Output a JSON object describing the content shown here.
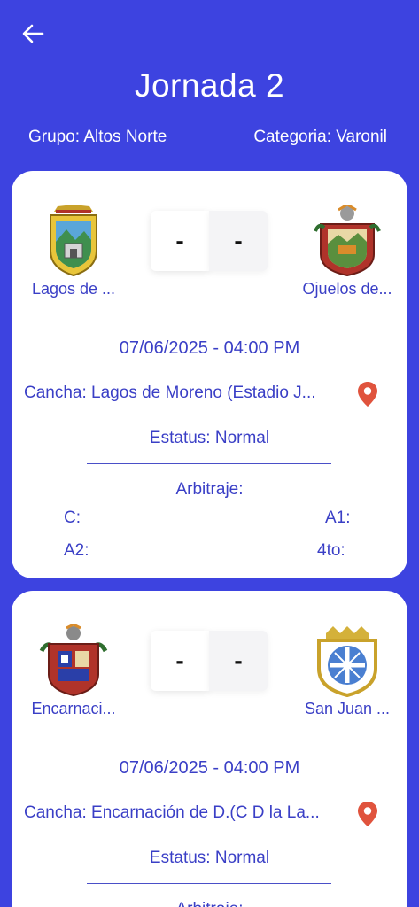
{
  "header": {
    "back_icon": "arrow-left-icon",
    "title": "Jornada 2",
    "group_text": "Grupo: Altos Norte",
    "category_text": "Categoria: Varonil"
  },
  "matches": [
    {
      "home_name": "Lagos de ...",
      "away_name": "Ojuelos de...",
      "home_score": "-",
      "away_score": "-",
      "datetime": "07/06/2025 - 04:00 PM",
      "venue": "Cancha: Lagos de Moreno (Estadio J...",
      "status": "Estatus: Normal",
      "referees_title": "Arbitraje:",
      "ref_c": "C:",
      "ref_a1": "A1:",
      "ref_a2": "A2:",
      "ref_4to": "4to:"
    },
    {
      "home_name": "Encarnaci...",
      "away_name": "San Juan ...",
      "home_score": "-",
      "away_score": "-",
      "datetime": "07/06/2025 - 04:00 PM",
      "venue": "Cancha: Encarnación de D.(C D la La...",
      "status": "Estatus: Normal",
      "referees_title": "Arbitraje:"
    }
  ],
  "colors": {
    "background": "#3d43e0",
    "text_accent": "#3a3fc6",
    "pin": "#e0533d"
  }
}
